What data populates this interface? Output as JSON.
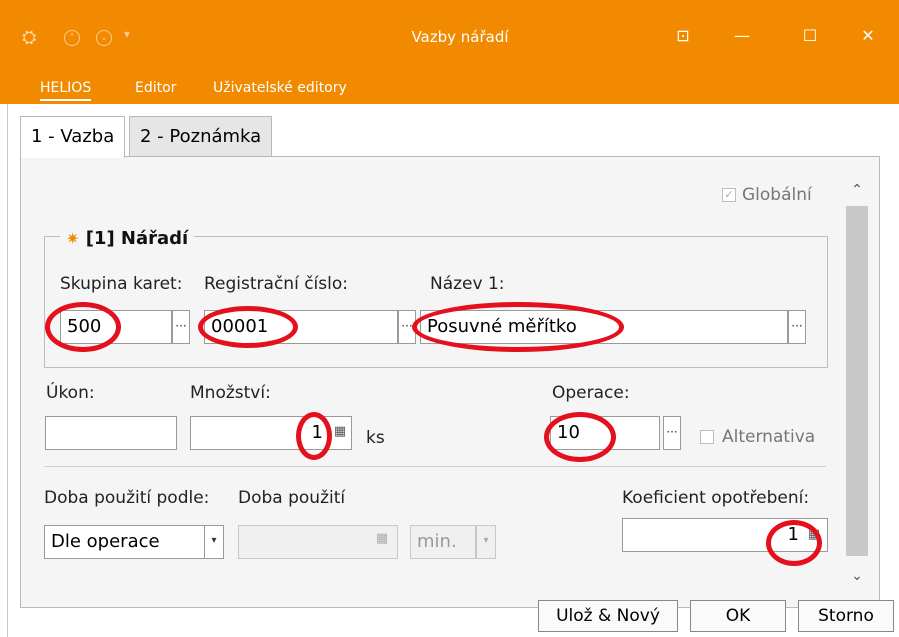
{
  "window": {
    "title": "Vazby nářadí",
    "menu": [
      "HELIOS",
      "Editor",
      "Uživatelské editory"
    ]
  },
  "tabs": [
    "1 - Vazba",
    "2 - Poznámka"
  ],
  "form": {
    "global_label": "Globální",
    "group_title": "[1] Nářadí",
    "skupina_label": "Skupina karet:",
    "skupina_value": "500",
    "reg_label": "Registrační číslo:",
    "reg_value": "00001",
    "nazev_label": "Název 1:",
    "nazev_value": "Posuvné měřítko",
    "ukon_label": "Úkon:",
    "ukon_value": "",
    "mnozstvi_label": "Množství:",
    "mnozstvi_value": "1",
    "mnozstvi_unit": "ks",
    "operace_label": "Operace:",
    "operace_value": "10",
    "alternativa_label": "Alternativa",
    "doba_podle_label": "Doba použití podle:",
    "doba_podle_value": "Dle operace",
    "doba_label": "Doba použití",
    "doba_value": "",
    "doba_unit": "min.",
    "koef_label": "Koeficient opotřebení:",
    "koef_value": "1"
  },
  "buttons": {
    "save_new": "Ulož & Nový",
    "ok": "OK",
    "cancel": "Storno"
  },
  "colors": {
    "titlebar": "#f28a00",
    "annotation": "#e4101e"
  }
}
